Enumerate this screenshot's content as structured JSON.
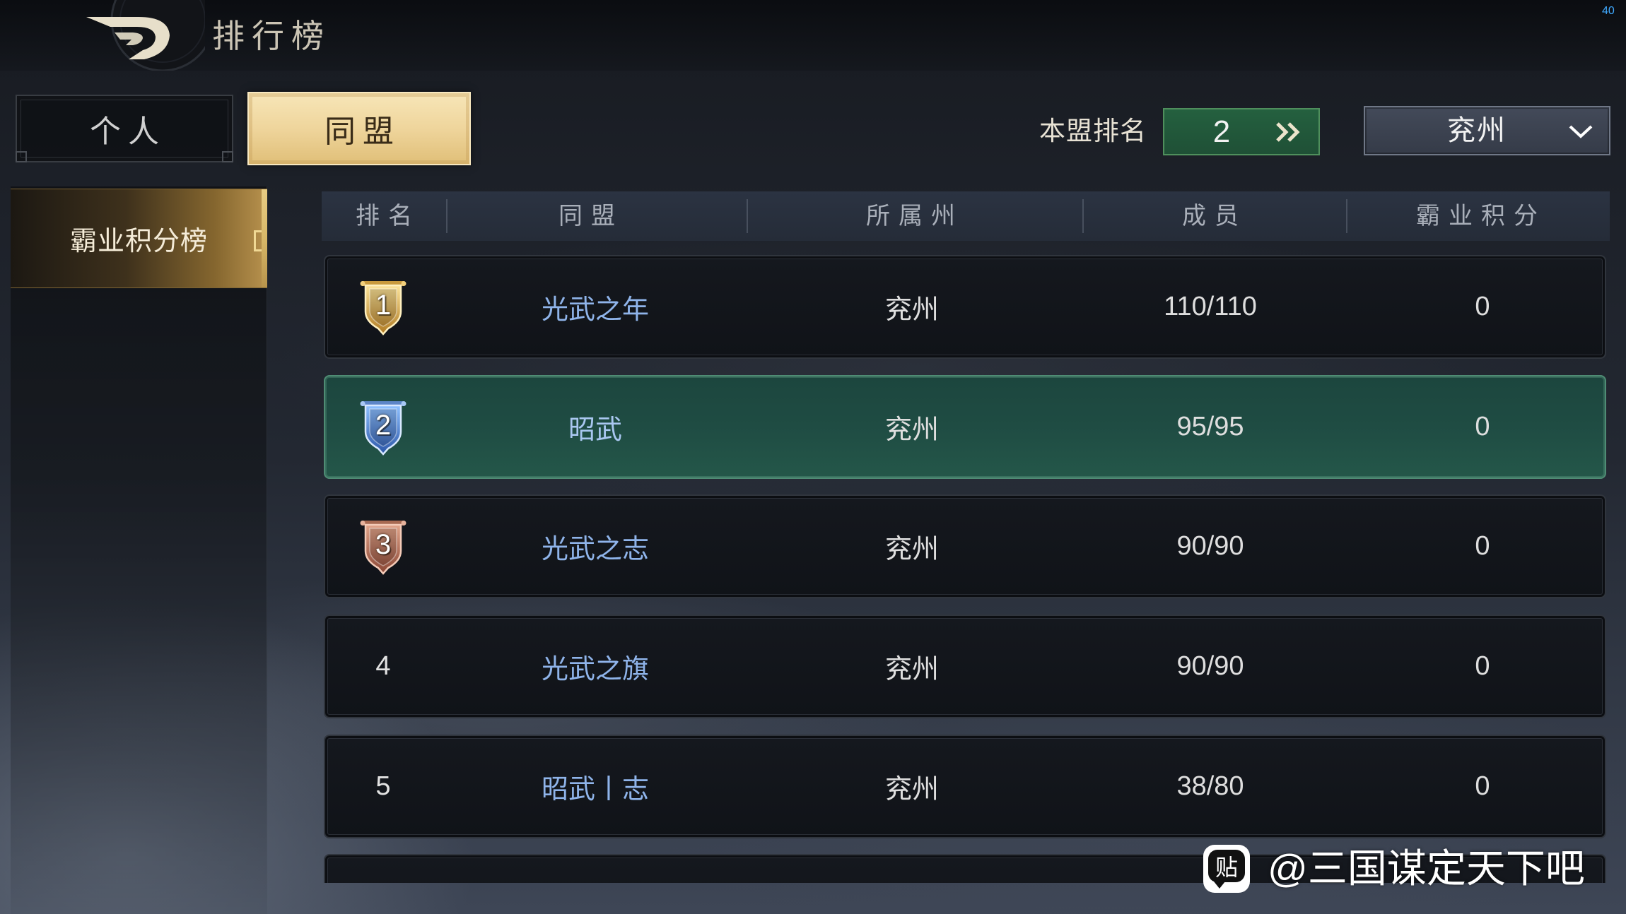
{
  "header": {
    "title": "排行榜",
    "fps": "40",
    "back_icon": "back-arrow-icon"
  },
  "tabs": {
    "personal": {
      "label": "个人",
      "active": false
    },
    "alliance": {
      "label": "同盟",
      "active": true
    }
  },
  "rank_summary": {
    "label": "本盟排名",
    "value": "2",
    "jump_icon": "double-chevron-right-icon"
  },
  "province_select": {
    "value": "兖州",
    "icon": "chevron-down-icon"
  },
  "sidebar": {
    "items": [
      {
        "label": "霸业积分榜",
        "selected": true
      }
    ]
  },
  "table": {
    "headers": {
      "rank": "排名",
      "alliance": "同盟",
      "province": "所属州",
      "members": "成员",
      "points": "霸业积分"
    },
    "rows": [
      {
        "rank": "1",
        "badge_icon": "gold-rank-badge-icon",
        "name": "光武之年",
        "province": "兖州",
        "members": "110/110",
        "points": "0",
        "highlighted": false
      },
      {
        "rank": "2",
        "badge_icon": "blue-rank-badge-icon",
        "name": "昭武",
        "province": "兖州",
        "members": "95/95",
        "points": "0",
        "highlighted": true
      },
      {
        "rank": "3",
        "badge_icon": "bronze-rank-badge-icon",
        "name": "光武之志",
        "province": "兖州",
        "members": "90/90",
        "points": "0",
        "highlighted": false
      },
      {
        "rank": "4",
        "badge_icon": null,
        "name": "光武之旗",
        "province": "兖州",
        "members": "90/90",
        "points": "0",
        "highlighted": false
      },
      {
        "rank": "5",
        "badge_icon": null,
        "name": "昭武丨志",
        "province": "兖州",
        "members": "38/80",
        "points": "0",
        "highlighted": false
      }
    ]
  },
  "watermark": {
    "icon_text": "贴",
    "text": "@三国谋定天下吧"
  },
  "theme": {
    "accent_gold": "#d8b868",
    "highlight_row": "#1f4c43",
    "alliance_name": "#8fb4ea",
    "text_primary": "#dedede",
    "rank_box": "#1f5036",
    "fps_color": "#3fa9ff"
  }
}
